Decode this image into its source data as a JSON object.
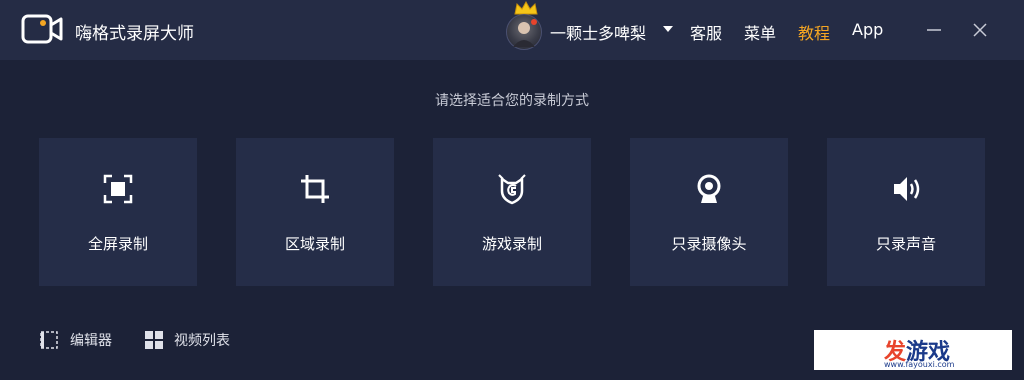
{
  "app": {
    "title": "嗨格式录屏大师"
  },
  "user": {
    "name": "一颗士多啤梨"
  },
  "nav": {
    "service": "客服",
    "menu": "菜单",
    "tutorial": "教程",
    "app": "App"
  },
  "colors": {
    "accent": "#f5a623",
    "background": "#1c2237",
    "card": "#252d48",
    "titlebar": "#252c45"
  },
  "main": {
    "prompt": "请选择适合您的录制方式",
    "modes": [
      {
        "label": "全屏录制",
        "icon": "fullscreen-icon"
      },
      {
        "label": "区域录制",
        "icon": "crop-icon"
      },
      {
        "label": "游戏录制",
        "icon": "game-icon"
      },
      {
        "label": "只录摄像头",
        "icon": "webcam-icon"
      },
      {
        "label": "只录声音",
        "icon": "speaker-icon"
      }
    ]
  },
  "bottom": {
    "editor": "编辑器",
    "video_list": "视频列表"
  },
  "watermark": {
    "main_a": "发",
    "main_b": "游戏",
    "url": "www.fayouxi.com"
  }
}
